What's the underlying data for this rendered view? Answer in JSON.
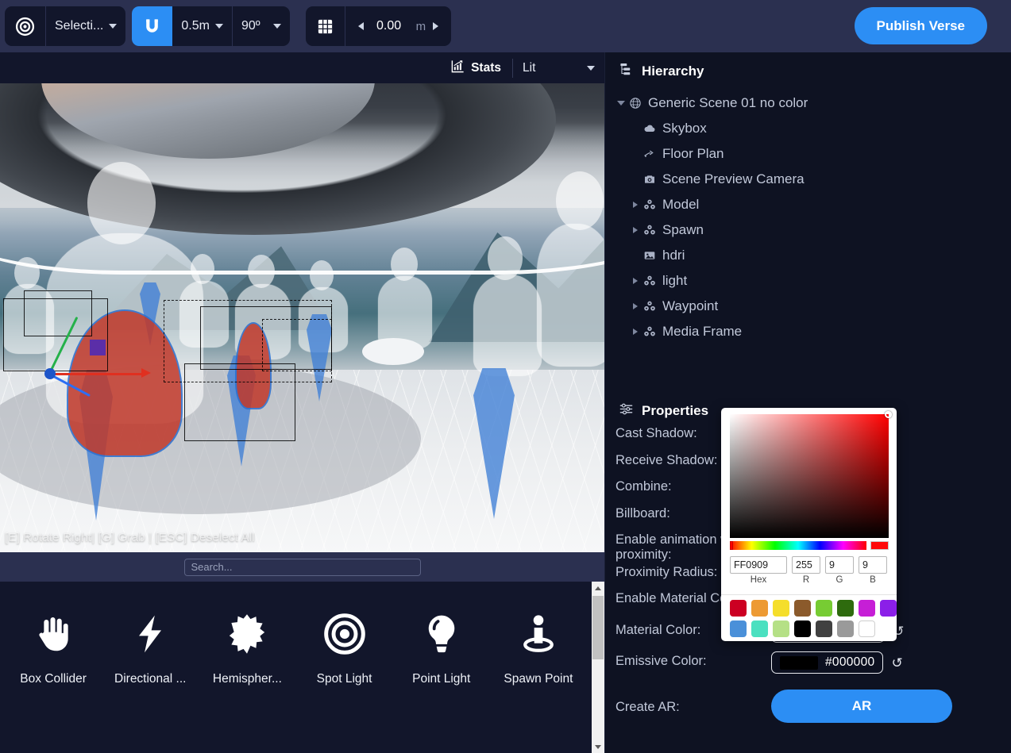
{
  "toolbar": {
    "mode_icon": "target-icon",
    "mode_label": "Selecti...",
    "snap_icon": "magnet-icon",
    "snap_distance": "0.5m",
    "snap_angle": "90º",
    "grid_icon": "grid-icon",
    "elevation_value": "0.00",
    "elevation_unit": "m",
    "publish_label": "Publish Verse",
    "accent_color": "#2c8ef4"
  },
  "viewport": {
    "stats_label": "Stats",
    "stats_icon": "chart-icon",
    "shading_mode": "Lit",
    "hint_text": "[E] Rotate Right| [G] Grab | [ESC] Deselect All"
  },
  "search": {
    "placeholder": "Search...",
    "value": ""
  },
  "assets": {
    "items": [
      {
        "label": "Box Collider",
        "icon": "hand-icon"
      },
      {
        "label": "Directional ...",
        "icon": "bolt-icon"
      },
      {
        "label": "Hemispher...",
        "icon": "starburst-icon"
      },
      {
        "label": "Spot Light",
        "icon": "concentric-circle-icon"
      },
      {
        "label": "Point Light",
        "icon": "lightbulb-icon"
      },
      {
        "label": "Spawn Point",
        "icon": "person-ring-icon"
      }
    ]
  },
  "hierarchy": {
    "title": "Hierarchy",
    "title_icon": "hierarchy-icon",
    "items": [
      {
        "label": "Generic Scene 01 no color",
        "icon": "globe-icon",
        "twisty": "down",
        "indent": 0
      },
      {
        "label": "Skybox",
        "icon": "cloud-icon",
        "twisty": "none",
        "indent": 1
      },
      {
        "label": "Floor Plan",
        "icon": "floorplan-icon",
        "twisty": "none",
        "indent": 1
      },
      {
        "label": "Scene Preview Camera",
        "icon": "camera-icon",
        "twisty": "none",
        "indent": 1
      },
      {
        "label": "Model",
        "icon": "cubes-icon",
        "twisty": "right",
        "indent": 1
      },
      {
        "label": "Spawn",
        "icon": "cubes-icon",
        "twisty": "right",
        "indent": 1
      },
      {
        "label": "hdri",
        "icon": "image-icon",
        "twisty": "none",
        "indent": 1
      },
      {
        "label": "light",
        "icon": "cubes-icon",
        "twisty": "right",
        "indent": 1
      },
      {
        "label": "Waypoint",
        "icon": "cubes-icon",
        "twisty": "right",
        "indent": 1
      },
      {
        "label": "Media Frame",
        "icon": "cubes-icon",
        "twisty": "right",
        "indent": 1
      }
    ]
  },
  "properties": {
    "title": "Properties",
    "title_icon": "sliders-icon",
    "rows": [
      {
        "label": "Cast Shadow:",
        "type": "none"
      },
      {
        "label": "Receive Shadow:",
        "type": "none"
      },
      {
        "label": "Combine:",
        "type": "none"
      },
      {
        "label": "Billboard:",
        "type": "none"
      },
      {
        "label": "Enable animation with proximity:",
        "type": "none"
      },
      {
        "label": "Proximity Radius:",
        "type": "none"
      },
      {
        "label": "Enable Material Color:",
        "type": "none"
      }
    ],
    "material_color": {
      "label": "Material Color:",
      "hex": "#FF0909",
      "reset_icon": "undo-icon"
    },
    "emissive_color": {
      "label": "Emissive Color:",
      "hex": "#000000",
      "reset_icon": "undo-icon"
    },
    "create_ar": {
      "label": "Create AR:",
      "button_label": "AR"
    }
  },
  "color_picker": {
    "hue_color": "#ff0000",
    "preview_color": "#FF0909",
    "hex_value": "FF0909",
    "hex_label": "Hex",
    "r_value": "255",
    "r_label": "R",
    "g_value": "9",
    "g_label": "G",
    "b_value": "9",
    "b_label": "B",
    "swatches": [
      "#CC0022",
      "#ED9A33",
      "#F5DE2B",
      "#8B5A2B",
      "#77CC33",
      "#2E6B0E",
      "#C61FD6",
      "#8B1FE8",
      "#4A90D9",
      "#4BE0C0",
      "#B5E086",
      "#000000",
      "#414141",
      "#9A9A9A",
      "#FFFFFF"
    ]
  }
}
